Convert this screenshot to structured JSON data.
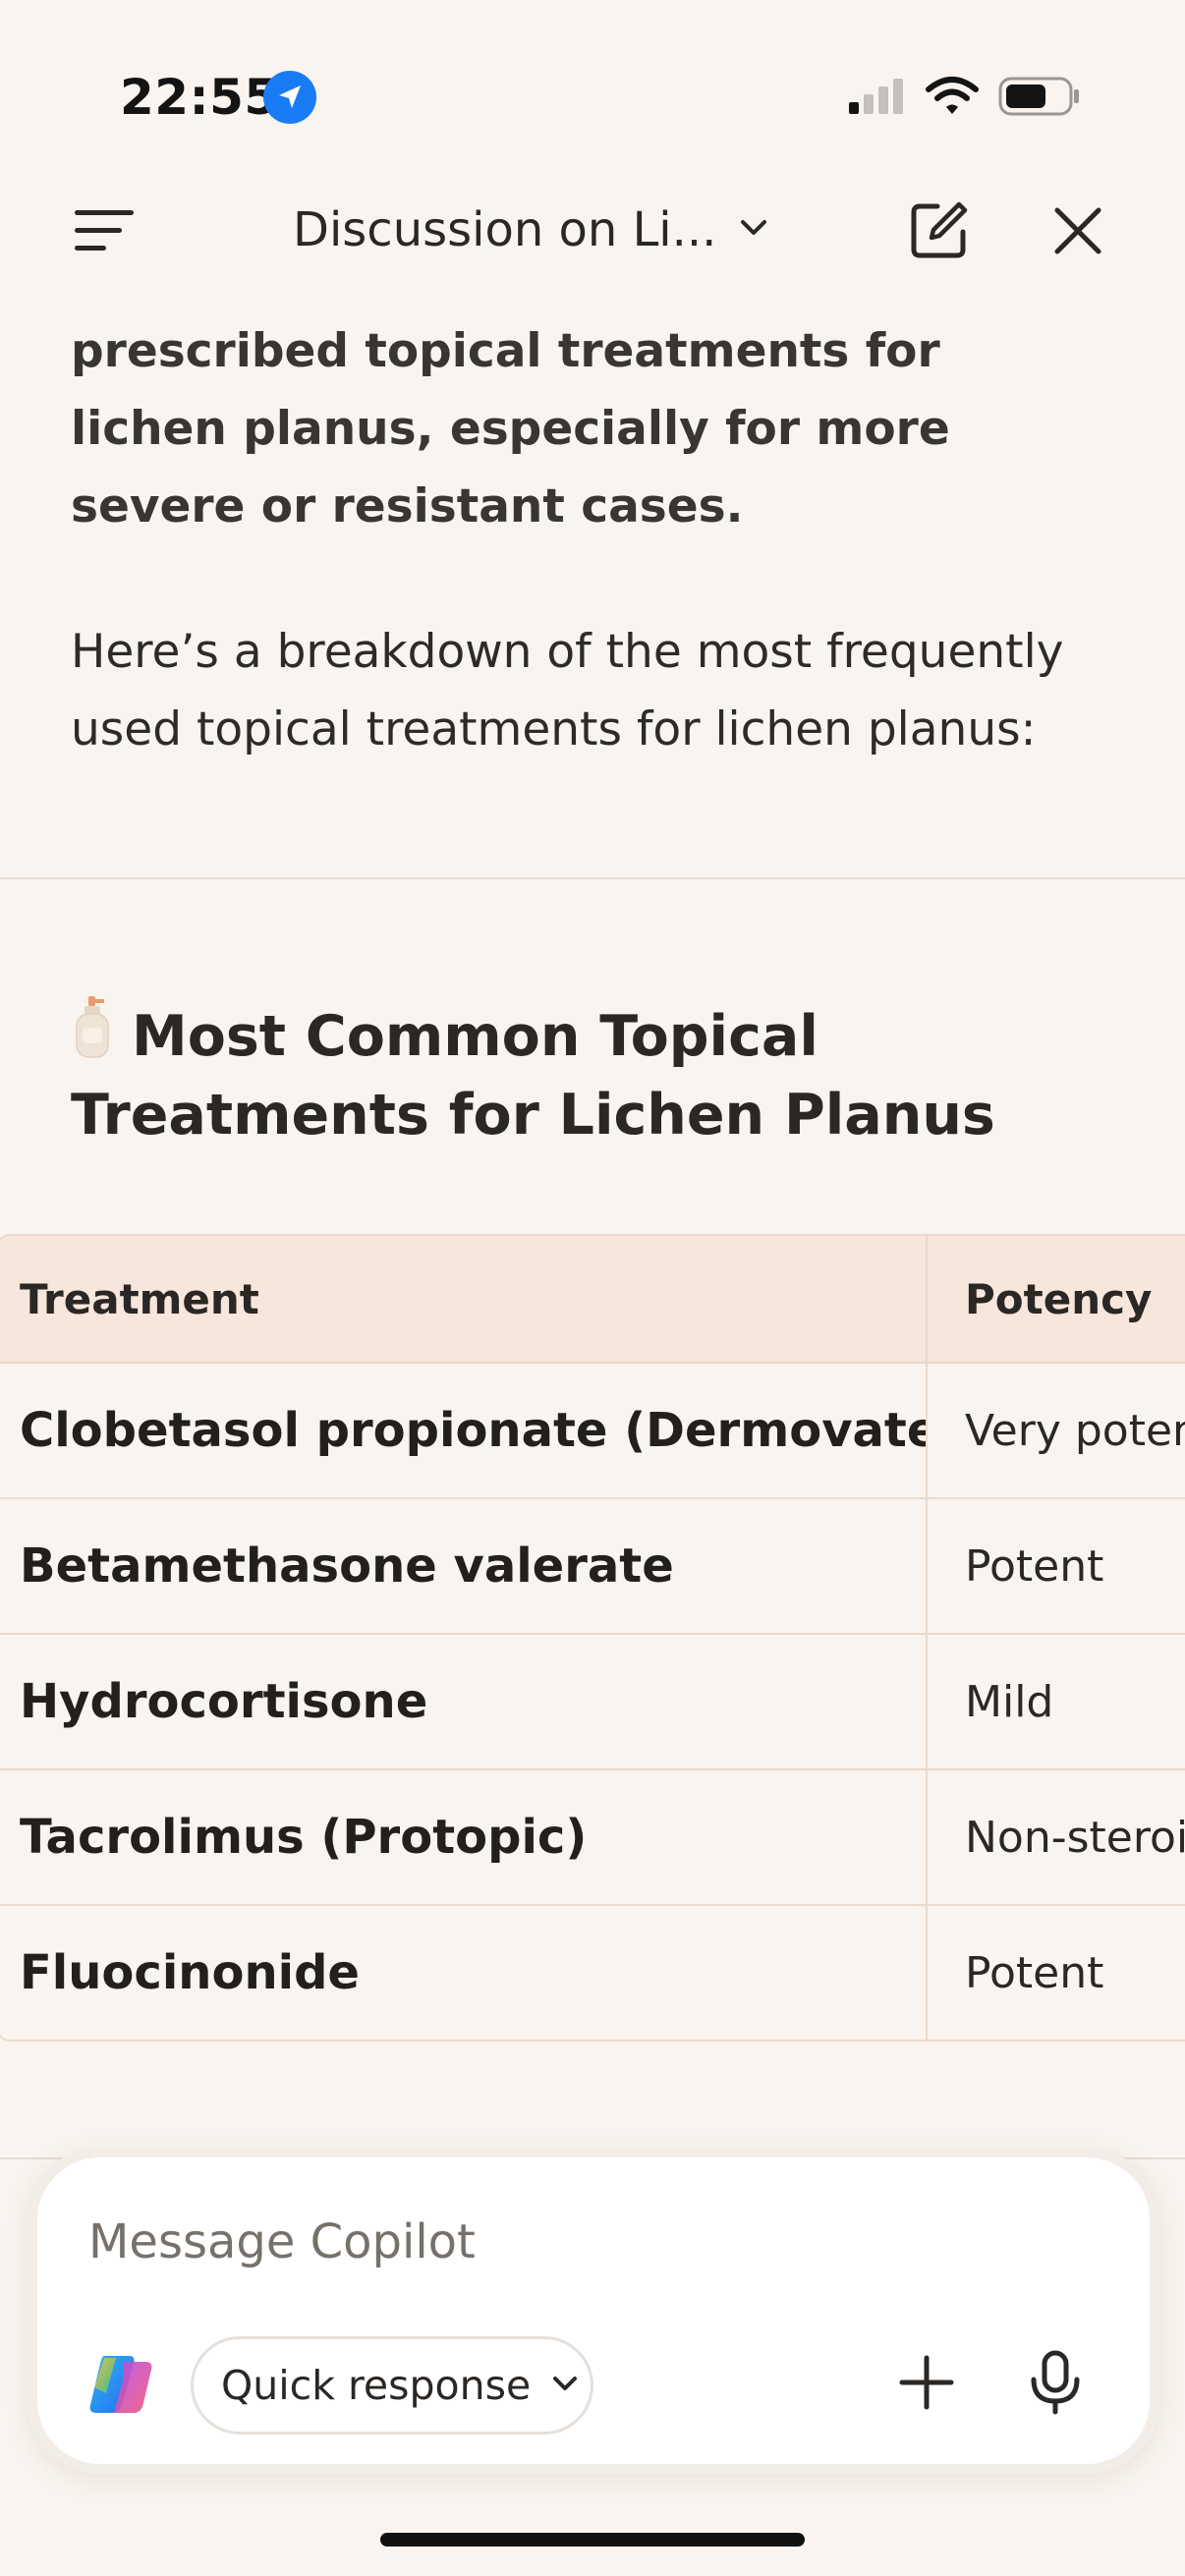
{
  "status_bar": {
    "time": "22:55",
    "icons": [
      "location-icon",
      "cellular-signal-icon",
      "wifi-icon",
      "battery-icon"
    ]
  },
  "header": {
    "title": "Discussion on Li...",
    "icons": [
      "menu-icon",
      "chevron-down-icon",
      "new-chat-icon",
      "close-icon"
    ]
  },
  "message": {
    "bold_text": "prescribed topical treatments for lichen planus, especially for more severe or resistant cases.",
    "intro_text": "Here’s a breakdown of the most frequently used topical treatments for lichen planus:",
    "section_heading": "Most Common Topical Treatments for Lichen Planus",
    "section_icon": "lotion-bottle-icon"
  },
  "table": {
    "headers": [
      "Treatment",
      "Potency"
    ],
    "rows": [
      {
        "treatment": "Clobetasol propionate (Dermovate)",
        "potency": "Very potent"
      },
      {
        "treatment": "Betamethasone valerate",
        "potency": "Potent"
      },
      {
        "treatment": "Hydrocortisone",
        "potency": "Mild"
      },
      {
        "treatment": "Tacrolimus (Protopic)",
        "potency": "Non-steroidal"
      },
      {
        "treatment": "Fluocinonide",
        "potency": "Potent"
      }
    ]
  },
  "composer": {
    "placeholder": "Message Copilot",
    "mode_label": "Quick response",
    "icons": [
      "copilot-logo-icon",
      "plus-icon",
      "microphone-icon"
    ]
  },
  "colors": {
    "background": "#f9f4ef",
    "table_header": "#f6e6dc",
    "table_border": "#ead9cc",
    "accent_blue": "#1a7cf5"
  }
}
